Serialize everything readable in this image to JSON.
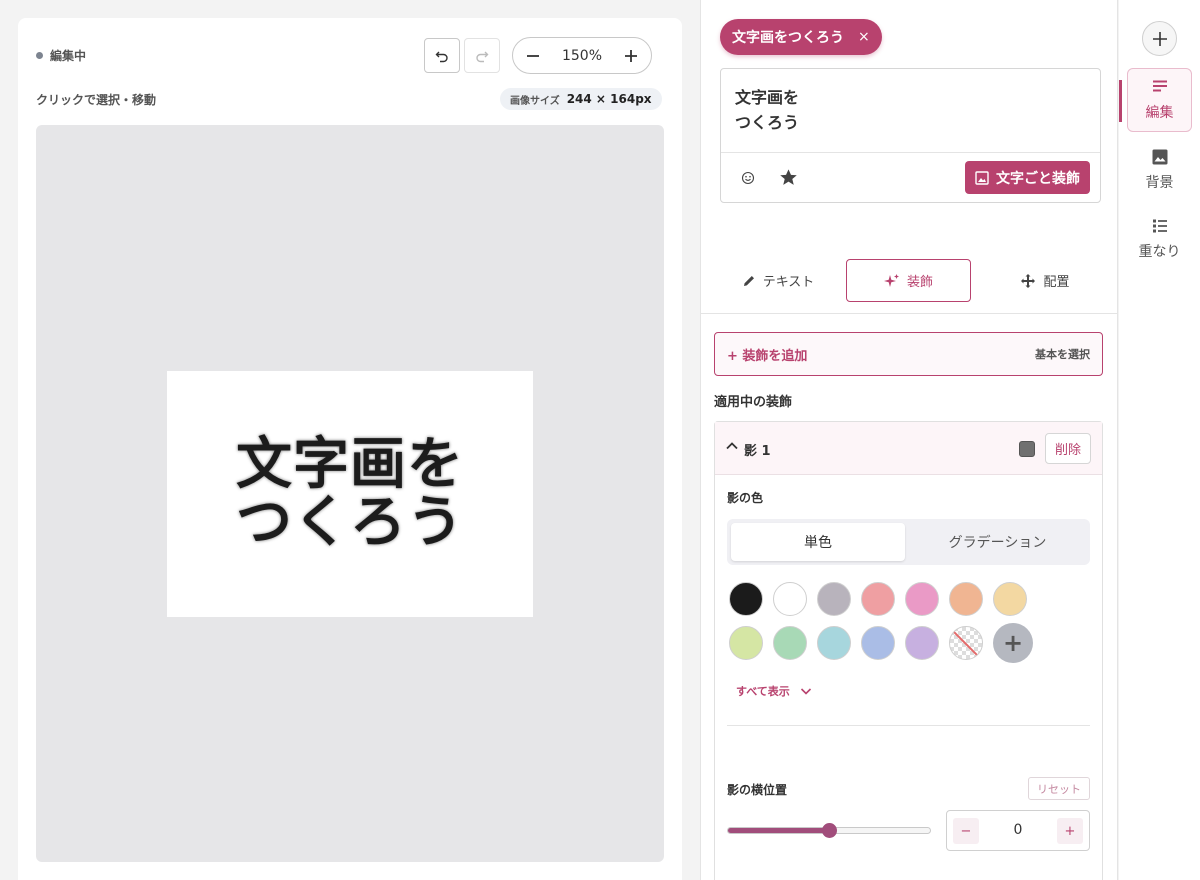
{
  "canvas": {
    "status": "編集中",
    "zoom": "150%",
    "hint": "クリックで選択・移動",
    "size_label": "画像サイズ",
    "size_value": "244 × 164px",
    "art_text": "文字画を\nつくろう"
  },
  "editor": {
    "chip_label": "文字画をつくろう",
    "chip_close": "×",
    "text_value": "文字画を\nつくろう",
    "decor_all_button": "文字ごと装飾",
    "tabs": [
      {
        "label": "テキスト",
        "icon": "pencil-icon"
      },
      {
        "label": "装飾",
        "icon": "sparkle-icon"
      },
      {
        "label": "配置",
        "icon": "move-icon"
      }
    ],
    "active_tab": "装飾",
    "add_decor": "+ 装飾を追加",
    "basic_select": "基本を選択",
    "applied_title": "適用中の装飾",
    "decoration": {
      "name": "影 1",
      "delete": "削除",
      "color_label": "影の色",
      "mode_single": "単色",
      "mode_gradient": "グラデーション",
      "active_mode": "単色",
      "swatch_color": "#707070",
      "palette": [
        "#1b1b1b",
        "#ffffff",
        "#b8b3bc",
        "#ef9fa2",
        "#ea9ac6",
        "#f0b592",
        "#f3d8a2",
        "#d5e6a4",
        "#a8d9b6",
        "#a7d6dd",
        "#aabde6",
        "#c7b0e0"
      ],
      "show_all": "すべて表示",
      "offset_x_label": "影の横位置",
      "reset": "リセット",
      "offset_x_value": "0",
      "offset_x_fraction": 0.5,
      "minus": "−",
      "plus": "+"
    }
  },
  "nav": {
    "items": [
      {
        "label": "編集",
        "icon": "edit-lines-icon"
      },
      {
        "label": "背景",
        "icon": "image-icon"
      },
      {
        "label": "重なり",
        "icon": "layers-list-icon"
      }
    ],
    "active": "編集"
  },
  "colors": {
    "accent": "#b8426e",
    "slider": "#a14d7b",
    "stage_bg": "#e6e6e8"
  }
}
